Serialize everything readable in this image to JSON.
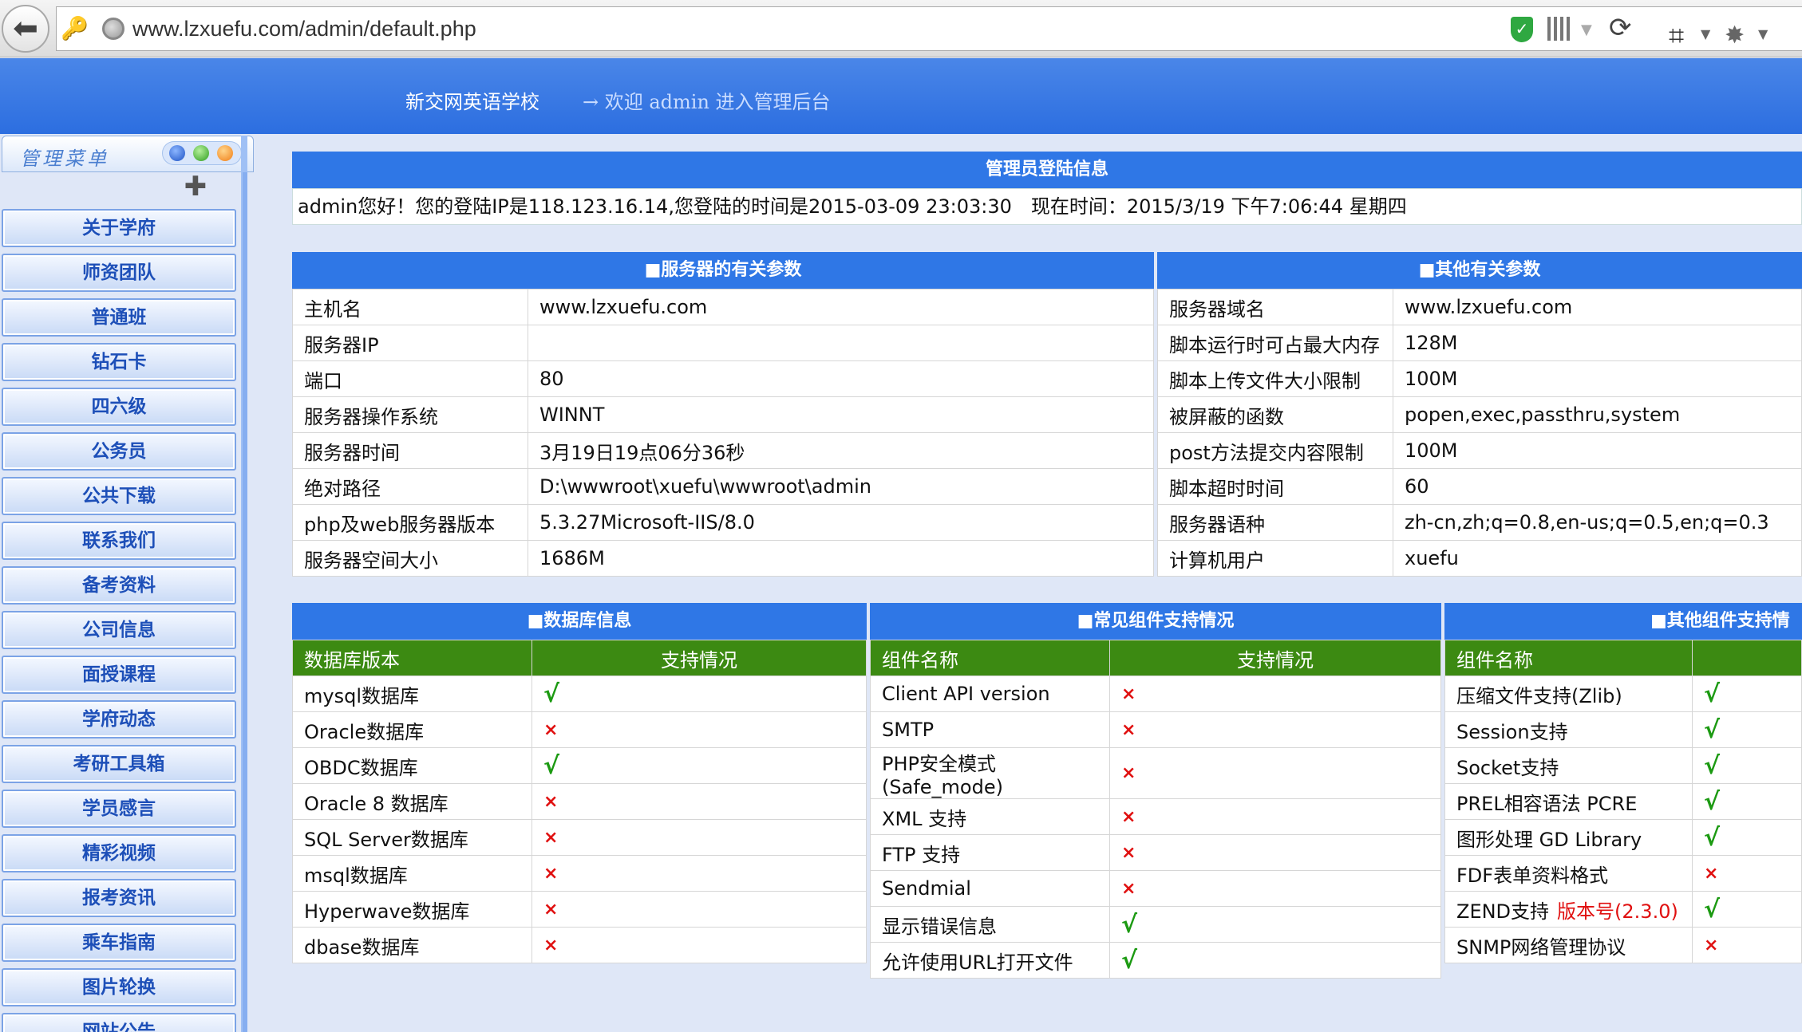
{
  "browser": {
    "back_glyph": "⬅",
    "url": "www.lzxuefu.com/admin/default.php",
    "reload_glyph": "⟳"
  },
  "header": {
    "school_name": "新交网英语学校",
    "welcome": "→ 欢迎 admin 进入管理后台"
  },
  "sidebar": {
    "title": "管理菜单",
    "items": [
      "关于学府",
      "师资团队",
      "普通班",
      "钻石卡",
      "四六级",
      "公务员",
      "公共下载",
      "联系我们",
      "备考资料",
      "公司信息",
      "面授课程",
      "学府动态",
      "考研工具箱",
      "学员感言",
      "精彩视频",
      "报考资讯",
      "乘车指南",
      "图片轮换",
      "网站公告"
    ]
  },
  "login": {
    "title": "管理员登陆信息",
    "text": "admin您好！您的登陆IP是118.123.16.14,您登陆的时间是2015-03-09 23:03:30　现在时间：2015/3/19 下午7:06:44 星期四"
  },
  "server": {
    "title": "■服务器的有关参数",
    "rows": [
      [
        "主机名",
        "www.lzxuefu.com"
      ],
      [
        "服务器IP",
        ""
      ],
      [
        "端口",
        "80"
      ],
      [
        "服务器操作系统",
        "WINNT"
      ],
      [
        "服务器时间",
        "3月19日19点06分36秒"
      ],
      [
        "绝对路径",
        "D:\\wwwroot\\xuefu\\wwwroot\\admin"
      ],
      [
        "php及web服务器版本",
        "5.3.27Microsoft-IIS/8.0"
      ],
      [
        "服务器空间大小",
        "1686M"
      ]
    ]
  },
  "other": {
    "title": "■其他有关参数",
    "rows": [
      [
        "服务器域名",
        "www.lzxuefu.com"
      ],
      [
        "脚本运行时可占最大内存",
        "128M"
      ],
      [
        "脚本上传文件大小限制",
        "100M"
      ],
      [
        "被屏蔽的函数",
        "popen,exec,passthru,system"
      ],
      [
        "post方法提交内容限制",
        "100M"
      ],
      [
        "脚本超时时间",
        "60"
      ],
      [
        "服务器语种",
        "zh-cn,zh;q=0.8,en-us;q=0.5,en;q=0.3"
      ],
      [
        "计算机用户",
        "xuefu"
      ]
    ]
  },
  "database": {
    "title": "■数据库信息",
    "col1": "数据库版本",
    "col2": "支持情况",
    "rows": [
      [
        "mysql数据库",
        "√"
      ],
      [
        "Oracle数据库",
        "×"
      ],
      [
        "OBDC数据库",
        "√"
      ],
      [
        "Oracle 8 数据库",
        "×"
      ],
      [
        "SQL Server数据库",
        "×"
      ],
      [
        "msql数据库",
        "×"
      ],
      [
        "Hyperwave数据库",
        "×"
      ],
      [
        "dbase数据库",
        "×"
      ]
    ]
  },
  "components": {
    "title": "■常见组件支持情况",
    "col1": "组件名称",
    "col2": "支持情况",
    "rows": [
      [
        "Client API version",
        "×"
      ],
      [
        "SMTP",
        "×"
      ],
      [
        "PHP安全模式(Safe_mode)",
        "×"
      ],
      [
        "XML 支持",
        "×"
      ],
      [
        "FTP 支持",
        "×"
      ],
      [
        "Sendmial",
        "×"
      ],
      [
        "显示错误信息",
        "√"
      ],
      [
        "允许使用URL打开文件",
        "√"
      ]
    ]
  },
  "other_components": {
    "title": "■其他组件支持情",
    "col1": "组件名称",
    "rows": [
      [
        "压缩文件支持(Zlib)",
        "√"
      ],
      [
        "Session支持",
        "√"
      ],
      [
        "Socket支持",
        "√"
      ],
      [
        "PREL相容语法 PCRE",
        "√"
      ],
      [
        "图形处理 GD Library",
        "√"
      ],
      [
        "FDF表单资料格式",
        "×"
      ],
      [
        "ZEND支持",
        "√"
      ],
      [
        "SNMP网络管理协议",
        "×"
      ]
    ],
    "zend_version": "版本号(2.3.0)"
  }
}
